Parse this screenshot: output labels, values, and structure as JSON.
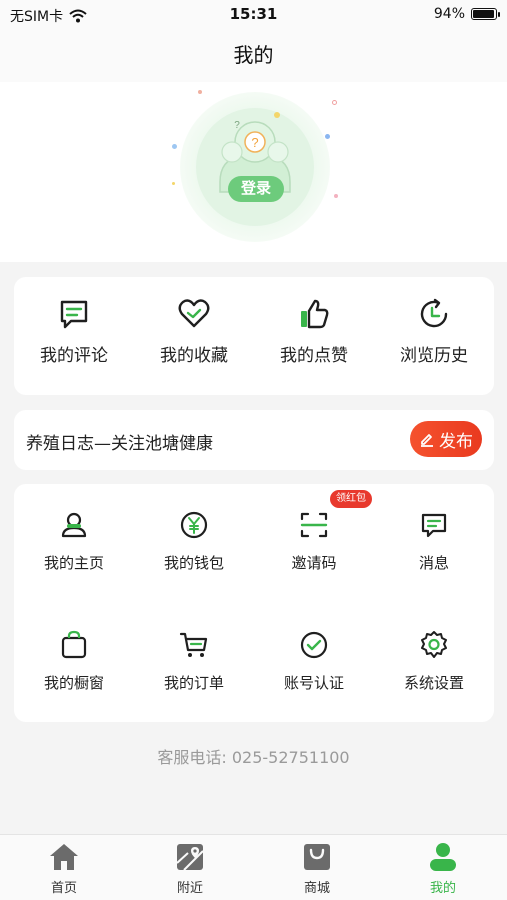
{
  "status_bar": {
    "carrier": "无SIM卡",
    "time": "15:31",
    "battery_percent": "94%",
    "battery_level": 0.94
  },
  "header": {
    "title": "我的"
  },
  "hero": {
    "login_label": "登录",
    "avatar_mark": "?"
  },
  "quick_actions": [
    {
      "label": "我的评论",
      "icon": "comment-icon"
    },
    {
      "label": "我的收藏",
      "icon": "heart-icon"
    },
    {
      "label": "我的点赞",
      "icon": "thumbs-up-icon"
    },
    {
      "label": "浏览历史",
      "icon": "history-icon"
    }
  ],
  "log_banner": {
    "text": "养殖日志—关注池塘健康",
    "button_label": "发布"
  },
  "grid": {
    "badge": "领红包",
    "items": [
      {
        "label": "我的主页",
        "icon": "user-icon"
      },
      {
        "label": "我的钱包",
        "icon": "wallet-icon"
      },
      {
        "label": "邀请码",
        "icon": "scan-icon"
      },
      {
        "label": "消息",
        "icon": "message-icon"
      },
      {
        "label": "我的橱窗",
        "icon": "shopping-bag-icon"
      },
      {
        "label": "我的订单",
        "icon": "cart-icon"
      },
      {
        "label": "账号认证",
        "icon": "check-circle-icon"
      },
      {
        "label": "系统设置",
        "icon": "gear-icon"
      }
    ]
  },
  "hotline": "客服电话: 025-52751100",
  "tab_bar": {
    "active": "我的",
    "tabs": [
      {
        "label": "首页",
        "icon": "home-icon"
      },
      {
        "label": "附近",
        "icon": "map-icon"
      },
      {
        "label": "商城",
        "icon": "shop-bag-icon"
      },
      {
        "label": "我的",
        "icon": "profile-icon"
      }
    ]
  },
  "colors": {
    "accent_green": "#39b54a",
    "publish_red": "#f5522e",
    "badge_red": "#e8392d",
    "icon_dark": "#1f1f1f"
  }
}
